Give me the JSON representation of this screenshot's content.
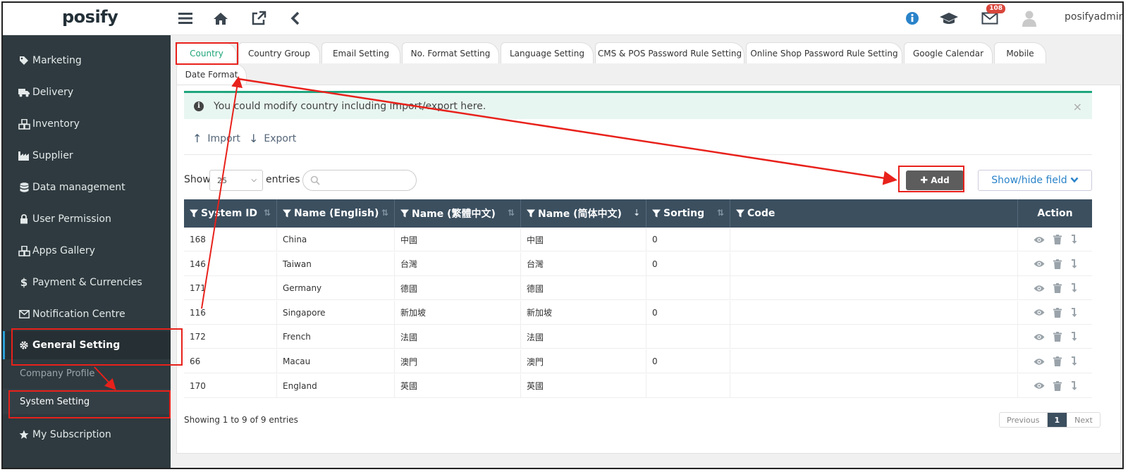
{
  "header": {
    "logo": "posify",
    "mail_badge": "108",
    "user_name": "posifyadmin",
    "icons": [
      "menu-icon",
      "home-icon",
      "external-link-icon",
      "back-chevron-icon",
      "info-icon",
      "graduation-cap-icon",
      "mail-icon",
      "avatar-icon"
    ]
  },
  "sidebar": {
    "items": [
      {
        "label": "Marketing",
        "icon": "tag-icon"
      },
      {
        "label": "Delivery",
        "icon": "truck-icon"
      },
      {
        "label": "Inventory",
        "icon": "cubes-icon"
      },
      {
        "label": "Supplier",
        "icon": "industry-icon"
      },
      {
        "label": "Data management",
        "icon": "database-icon"
      },
      {
        "label": "User Permission",
        "icon": "lock-icon"
      },
      {
        "label": "Apps Gallery",
        "icon": "cubes-icon"
      },
      {
        "label": "Payment & Currencies",
        "icon": "dollar-icon"
      },
      {
        "label": "Notification Centre",
        "icon": "envelope-icon"
      },
      {
        "label": "General Setting",
        "icon": "gear-icon"
      },
      {
        "label": "My Subscription",
        "icon": "star-icon"
      }
    ],
    "sub_items": [
      "Company Profile",
      "System Setting"
    ]
  },
  "tabs": [
    "Country",
    "Country Group",
    "Email Setting",
    "No. Format Setting",
    "Language Setting",
    "CMS & POS Password Rule Setting",
    "Online Shop Password Rule Setting",
    "Google Calendar",
    "Mobile",
    "Date Format"
  ],
  "alert": {
    "text": "You could modify country including import/export here.",
    "close": "×"
  },
  "toolbar": {
    "import": "Import",
    "export": "Export",
    "add": "Add",
    "show_hide": "Show/hide field"
  },
  "list": {
    "show": "Show",
    "entries_value": "25",
    "entries": "entries",
    "search_placeholder": ""
  },
  "table": {
    "columns": [
      "System ID",
      "Name (English)",
      "Name (繁體中文)",
      "Name (简体中文)",
      "Sorting",
      "Code",
      "Action"
    ],
    "rows": [
      [
        "168",
        "China",
        "中國",
        "中國",
        "0",
        ""
      ],
      [
        "146",
        "Taiwan",
        "台灣",
        "台灣",
        "0",
        ""
      ],
      [
        "171",
        "Germany",
        "德國",
        "德國",
        "",
        ""
      ],
      [
        "116",
        "Singapore",
        "新加坡",
        "新加坡",
        "0",
        ""
      ],
      [
        "172",
        "French",
        "法國",
        "法國",
        "",
        ""
      ],
      [
        "66",
        "Macau",
        "澳門",
        "澳門",
        "0",
        ""
      ],
      [
        "170",
        "England",
        "英國",
        "英國",
        "",
        ""
      ]
    ]
  },
  "footer": {
    "showing": "Showing 1 to 9 of 9 entries",
    "prev": "Previous",
    "page": "1",
    "next": "Next"
  },
  "colors": {
    "sidebar_bg": "#2e3a3f",
    "table_header": "#3b4f5f",
    "accent_green": "#1fa67f",
    "annotation_red": "#e8211b"
  }
}
